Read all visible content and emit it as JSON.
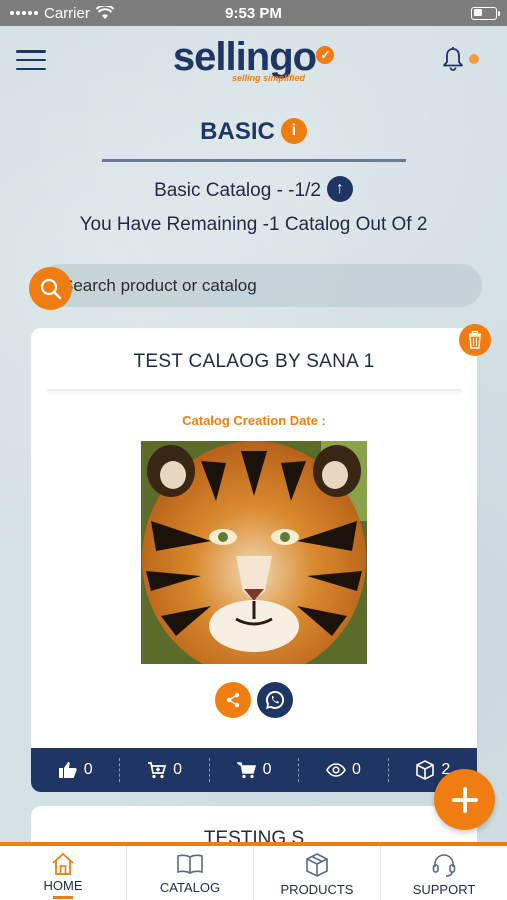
{
  "status_bar": {
    "carrier": "Carrier",
    "time": "9:53 PM"
  },
  "header": {
    "logo_text": "sellingo",
    "logo_tagline": "selling simplified"
  },
  "plan": {
    "name": "BASIC",
    "catalog_text": "Basic Catalog - -1/2",
    "remaining_text": "You Have Remaining -1 Catalog Out Of 2"
  },
  "search": {
    "placeholder": "Search product or catalog"
  },
  "catalog_card": {
    "title": "TEST CALAOG BY SANA 1",
    "date_label": "Catalog Creation Date :",
    "image": "tiger-image",
    "stats": {
      "likes": "0",
      "cart_adds": "0",
      "cart": "0",
      "views": "0",
      "products": "2"
    }
  },
  "next_card": {
    "title": "TESTING S"
  },
  "bottom_nav": [
    {
      "label": "HOME",
      "icon": "home-icon",
      "active": true
    },
    {
      "label": "CATALOG",
      "icon": "book-icon",
      "active": false
    },
    {
      "label": "PRODUCTS",
      "icon": "box-icon",
      "active": false
    },
    {
      "label": "SUPPORT",
      "icon": "headset-icon",
      "active": false
    }
  ],
  "colors": {
    "accent": "#f07d12",
    "navy": "#1f3563"
  }
}
